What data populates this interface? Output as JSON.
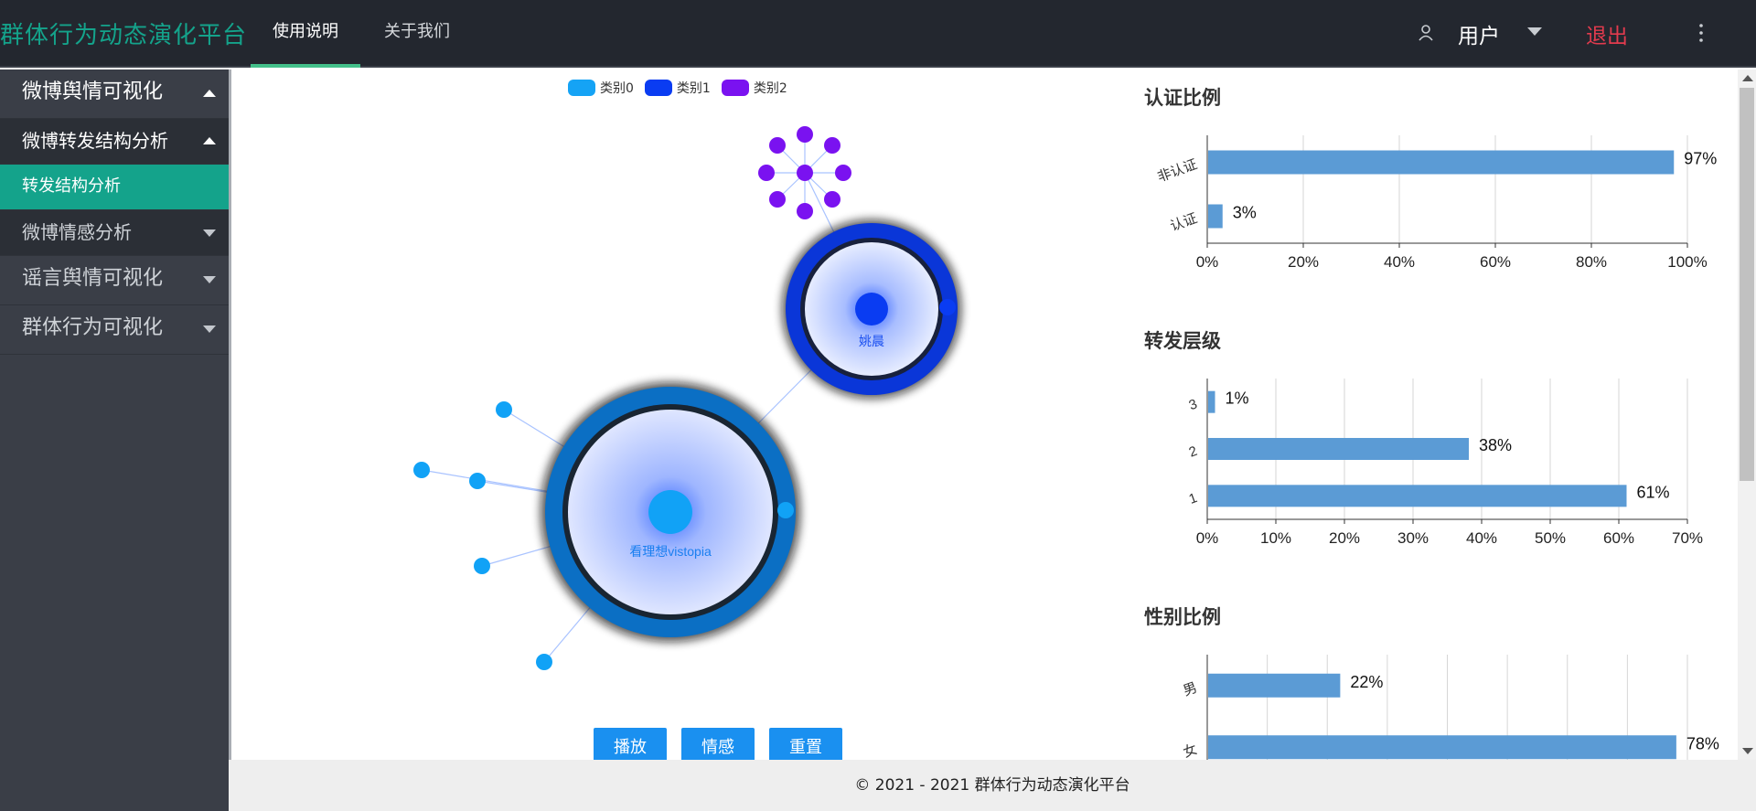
{
  "header": {
    "brand": "群体行为动态演化平台",
    "tabs": [
      {
        "label": "使用说明",
        "active": true
      },
      {
        "label": "关于我们",
        "active": false
      }
    ],
    "user_label": "用户",
    "logout_label": "退出"
  },
  "sidebar": {
    "items": [
      {
        "label": "微博舆情可视化",
        "level": 1,
        "state": "open"
      },
      {
        "label": "微博转发结构分析",
        "level": 2,
        "state": "open"
      },
      {
        "label": "转发结构分析",
        "level": 3,
        "state": "selected"
      },
      {
        "label": "微博情感分析",
        "level": 2,
        "state": "closed"
      },
      {
        "label": "谣言舆情可视化",
        "level": 1,
        "state": "closed"
      },
      {
        "label": "群体行为可视化",
        "level": 1,
        "state": "closed"
      }
    ]
  },
  "graph": {
    "legend": [
      {
        "label": "类别0",
        "color": "#15a3f5"
      },
      {
        "label": "类别1",
        "color": "#0a3cf2"
      },
      {
        "label": "类别2",
        "color": "#7a12f0"
      }
    ],
    "node_labels": {
      "hub_a": "看理想vistopia",
      "hub_b": "姚晨"
    },
    "buttons": [
      "播放",
      "情感",
      "重置"
    ]
  },
  "chart_data": [
    {
      "type": "bar",
      "orientation": "horizontal",
      "title": "认证比例",
      "categories": [
        "非认证",
        "认证"
      ],
      "values": [
        97,
        3
      ],
      "value_labels": [
        "97%",
        "3%"
      ],
      "xlim": [
        0,
        100
      ],
      "xticks": [
        "0%",
        "20%",
        "40%",
        "60%",
        "80%",
        "100%"
      ],
      "grid": true
    },
    {
      "type": "bar",
      "orientation": "horizontal",
      "title": "转发层级",
      "categories": [
        "3",
        "2",
        "1"
      ],
      "values": [
        1,
        38,
        61
      ],
      "value_labels": [
        "1%",
        "38%",
        "61%"
      ],
      "xlim": [
        0,
        70
      ],
      "xticks": [
        "0%",
        "10%",
        "20%",
        "30%",
        "40%",
        "50%",
        "60%",
        "70%"
      ],
      "grid": true
    },
    {
      "type": "bar",
      "orientation": "horizontal",
      "title": "性别比例",
      "categories": [
        "男",
        "女"
      ],
      "values": [
        22,
        78
      ],
      "value_labels": [
        "22%",
        "78%"
      ],
      "xlim": [
        0,
        80
      ],
      "grid": true
    }
  ],
  "footer": {
    "text": "© 2021 - 2021 群体行为动态演化平台"
  }
}
